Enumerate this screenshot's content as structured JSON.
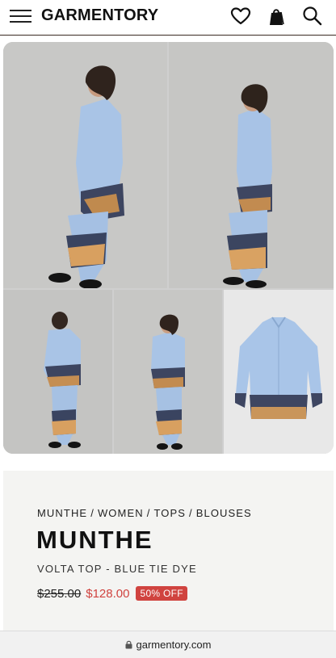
{
  "header": {
    "logo": "GARMENTORY",
    "icons": [
      "hamburger-menu-icon",
      "heart-icon",
      "shopping-bag-icon",
      "search-icon"
    ]
  },
  "gallery": {
    "images": [
      {
        "name": "model-side-view"
      },
      {
        "name": "model-three-quarter-view"
      },
      {
        "name": "model-back-view"
      },
      {
        "name": "model-front-view"
      },
      {
        "name": "shirt-flat-lay"
      }
    ]
  },
  "product": {
    "breadcrumb": [
      "MUNTHE",
      "WOMEN",
      "TOPS",
      "BLOUSES"
    ],
    "breadcrumb_separator": "/",
    "brand": "MUNTHE",
    "name": "VOLTA TOP - BLUE TIE DYE",
    "original_price": "$255.00",
    "sale_price": "$128.00",
    "discount_badge": "50% OFF"
  },
  "browser": {
    "url": "garmentory.com"
  },
  "colors": {
    "sale_red": "#d0433f",
    "header_border": "#3a2a22",
    "info_bg": "#f4f4f2"
  }
}
